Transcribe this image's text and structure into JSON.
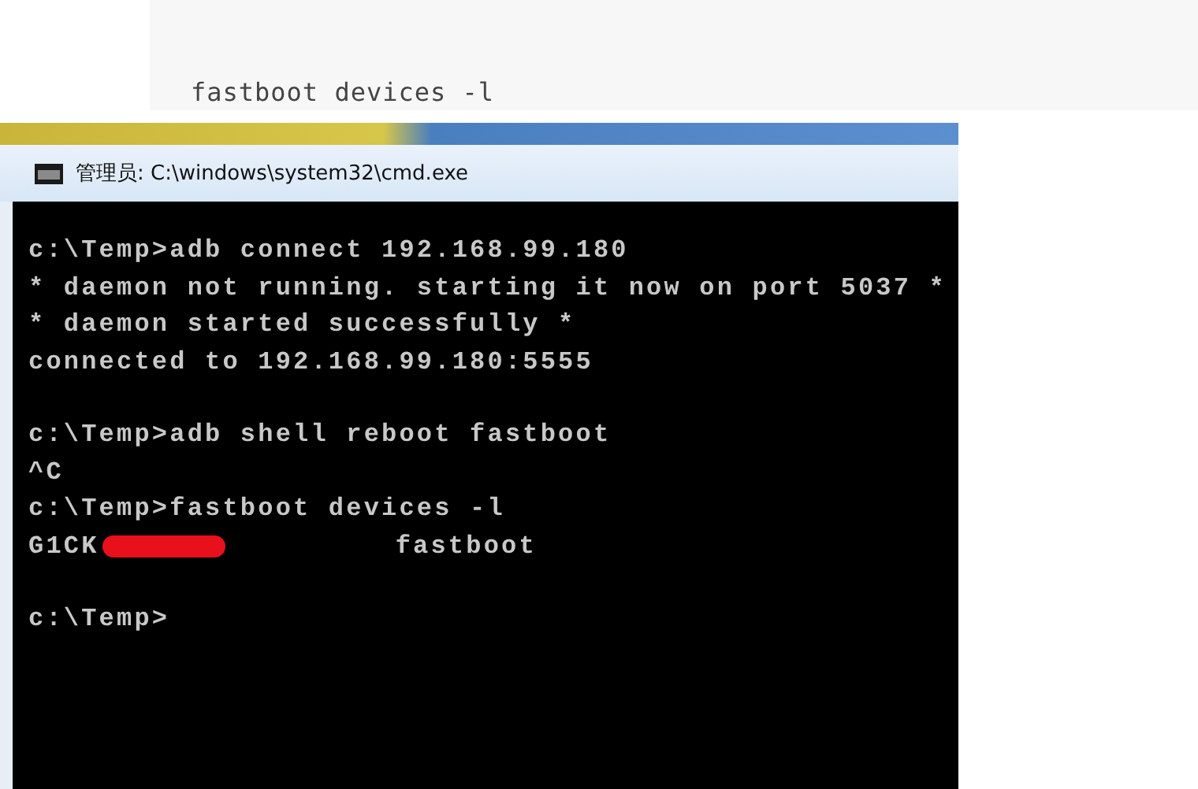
{
  "code_block": {
    "text": "fastboot devices -l"
  },
  "console_window": {
    "title": "管理员: C:\\windows\\system32\\cmd.exe",
    "blocks": [
      [
        {
          "kind": "text",
          "text": "c:\\Temp>adb connect 192.168.99.180"
        },
        {
          "kind": "text",
          "text": "* daemon not running. starting it now on port 5037 *"
        },
        {
          "kind": "text",
          "text": "* daemon started successfully *"
        },
        {
          "kind": "text",
          "text": "connected to 192.168.99.180:5555"
        }
      ],
      [
        {
          "kind": "text",
          "text": "c:\\Temp>adb shell reboot fastboot"
        },
        {
          "kind": "text",
          "text": "^C"
        },
        {
          "kind": "text",
          "text": "c:\\Temp>fastboot devices -l"
        },
        {
          "kind": "device",
          "serial": "G1CK",
          "status": "fastboot"
        }
      ],
      [
        {
          "kind": "text",
          "text": "c:\\Temp>"
        }
      ]
    ]
  }
}
